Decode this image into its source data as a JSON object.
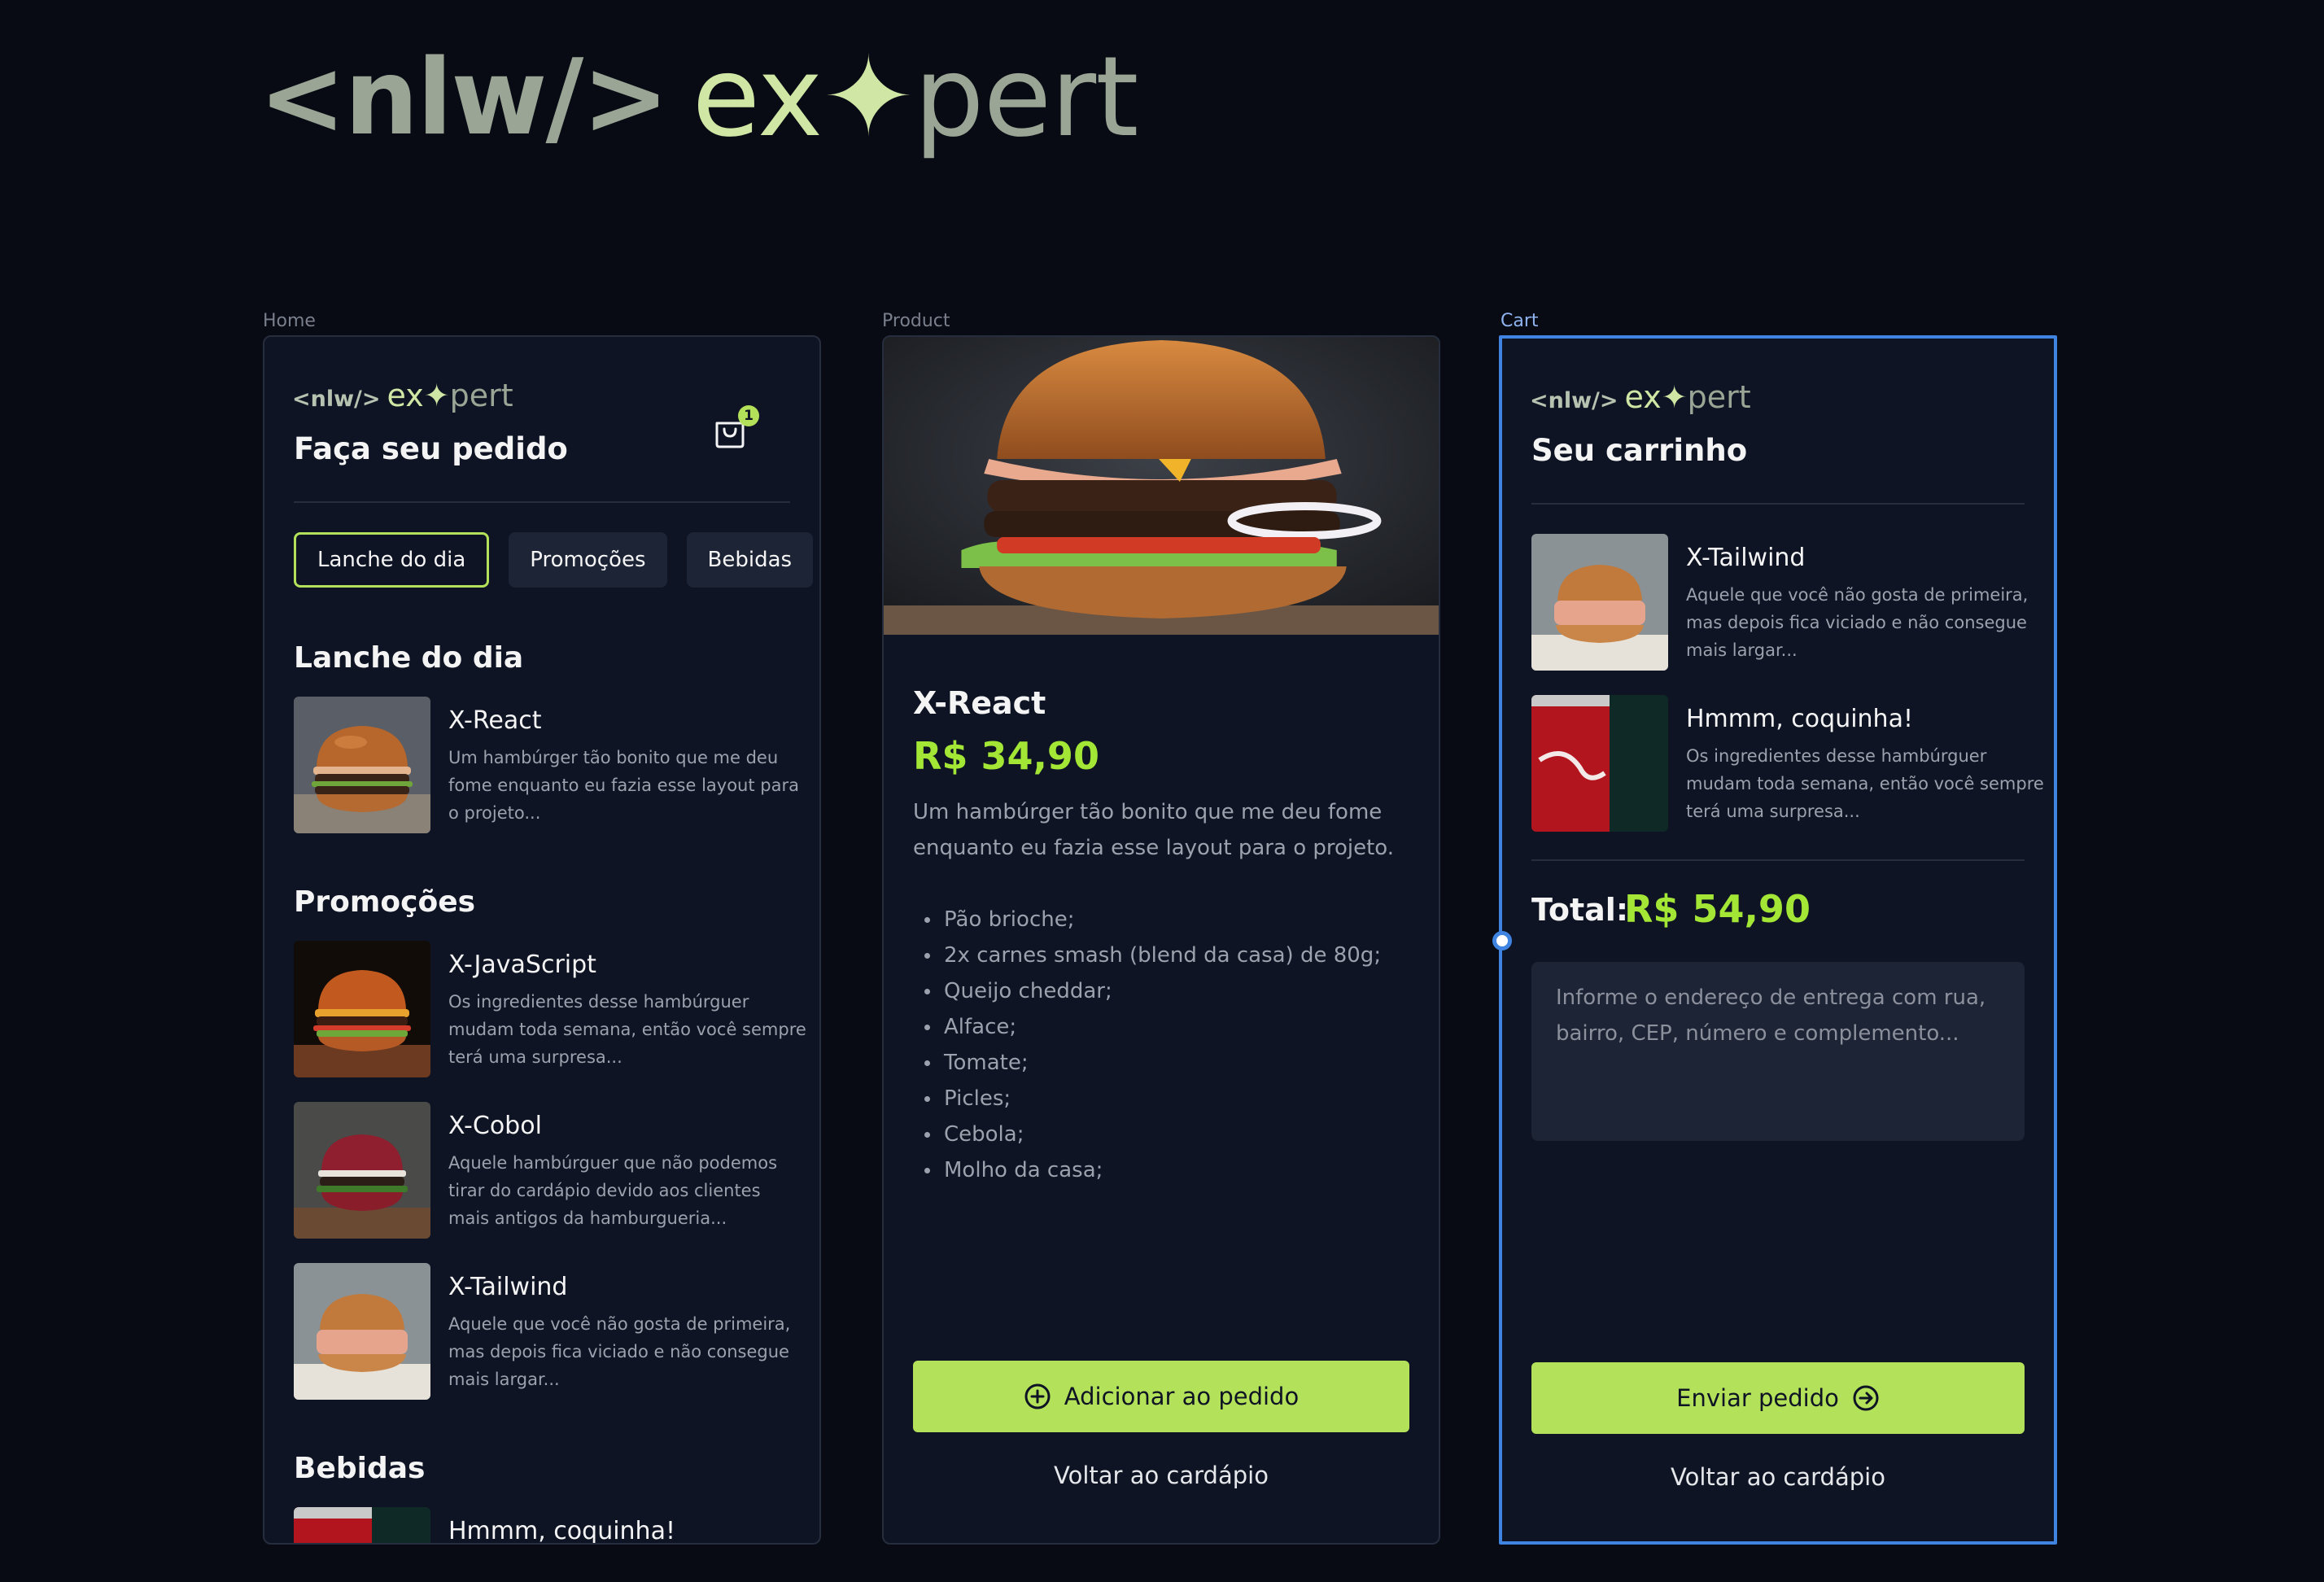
{
  "brand": {
    "nlw": "<nlw/>",
    "ex": "ex",
    "star": "✦",
    "ert": "pert"
  },
  "frames": {
    "home": "Home",
    "product": "Product",
    "cart": "Cart"
  },
  "home": {
    "title": "Faça seu pedido",
    "cart_count": "1",
    "tabs": [
      "Lanche do dia",
      "Promoções",
      "Bebidas"
    ],
    "section_daily": "Lanche do dia",
    "daily": [
      {
        "name": "X-React",
        "desc": "Um hambúrger tão bonito que me deu fome enquanto eu fazia esse layout para o projeto..."
      }
    ],
    "section_promos": "Promoções",
    "promos": [
      {
        "name": "X-JavaScript",
        "desc": "Os ingredientes desse hambúrguer mudam toda semana, então você sempre terá uma surpresa..."
      },
      {
        "name": "X-Cobol",
        "desc": "Aquele hambúrguer que não podemos tirar do cardápio devido aos clientes mais antigos da hamburgueria..."
      },
      {
        "name": "X-Tailwind",
        "desc": "Aquele que você não gosta de primeira, mas depois fica viciado e não consegue mais largar..."
      }
    ],
    "section_drinks": "Bebidas",
    "drinks": [
      {
        "name": "Hmmm, coquinha!"
      }
    ]
  },
  "product": {
    "name": "X-React",
    "price": "R$ 34,90",
    "desc": "Um hambúrger tão bonito que me deu fome enquanto eu fazia esse layout para o projeto.",
    "ingredients": [
      "Pão brioche;",
      "2x carnes smash (blend da casa) de 80g;",
      "Queijo cheddar;",
      "Alface;",
      "Tomate;",
      "Picles;",
      "Cebola;",
      "Molho da casa;"
    ],
    "add_button": "Adicionar ao pedido",
    "back": "Voltar ao cardápio"
  },
  "cart": {
    "title": "Seu carrinho",
    "items": [
      {
        "name": "X-Tailwind",
        "desc": "Aquele que você não gosta de primeira, mas depois fica viciado e não consegue mais largar..."
      },
      {
        "name": "Hmmm, coquinha!",
        "desc": "Os ingredientes desse hambúrguer mudam toda semana, então você sempre terá uma surpresa..."
      }
    ],
    "total_label": "Total:",
    "total_value": "R$ 54,90",
    "address_placeholder": "Informe o endereço de entrega com rua, bairro, CEP, número e complemento...",
    "send_button": "Enviar pedido",
    "back": "Voltar ao cardápio"
  },
  "colors": {
    "accent": "#b4e15a",
    "price": "#a3e635",
    "bg": "#0e1423",
    "selection": "#3e84e0"
  }
}
